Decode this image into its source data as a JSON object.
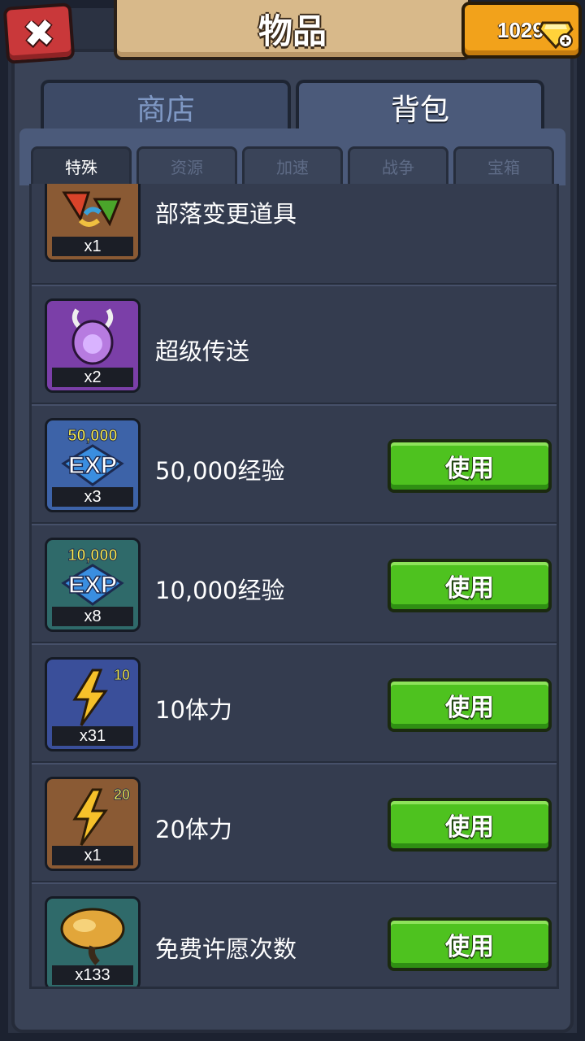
{
  "header": {
    "title": "物品",
    "close_icon": "close-x-icon",
    "gems": "1029",
    "gem_icon": "gem-plus-icon"
  },
  "main_tabs": [
    {
      "label": "商店",
      "active": false
    },
    {
      "label": "背包",
      "active": true
    }
  ],
  "sub_tabs": [
    {
      "label": "特殊",
      "active": true
    },
    {
      "label": "资源",
      "active": false
    },
    {
      "label": "加速",
      "active": false
    },
    {
      "label": "战争",
      "active": false
    },
    {
      "label": "宝箱",
      "active": false
    }
  ],
  "items": [
    {
      "name": "部落变更道具",
      "qty": "x1",
      "icon": "tribe-change-flags-icon",
      "bg": "#8a5a34",
      "use_label": ""
    },
    {
      "name": "超级传送",
      "qty": "x2",
      "icon": "super-teleport-icon",
      "bg": "#7b3fa8",
      "use_label": ""
    },
    {
      "name": "50,000经验",
      "qty": "x3",
      "icon": "exp-50000-icon",
      "bg": "#3d63a8",
      "icon_text": "50,000",
      "use_label": "使用"
    },
    {
      "name": "10,000经验",
      "qty": "x8",
      "icon": "exp-10000-icon",
      "bg": "#2f6a6a",
      "icon_text": "10,000",
      "use_label": "使用"
    },
    {
      "name": "10体力",
      "qty": "x31",
      "icon": "energy-10-icon",
      "bg": "#3a4f9a",
      "icon_text": "10",
      "use_label": "使用"
    },
    {
      "name": "20体力",
      "qty": "x1",
      "icon": "energy-20-icon",
      "bg": "#8a5a34",
      "icon_text": "20",
      "use_label": "使用"
    },
    {
      "name": "免费许愿次数",
      "qty": "x133",
      "icon": "wish-tree-icon",
      "bg": "#2f6a6a",
      "use_label": "使用"
    }
  ],
  "icon_labels": {
    "exp": "EXP"
  }
}
